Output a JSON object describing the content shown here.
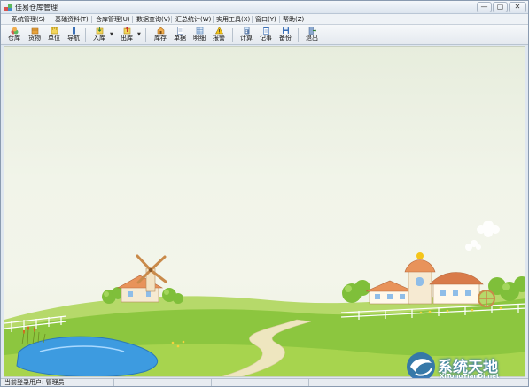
{
  "window": {
    "title": "佳易仓库管理",
    "minimize_label": "—",
    "maximize_label": "▢",
    "close_label": "✕"
  },
  "menu": [
    {
      "label": "系统管理(S)"
    },
    {
      "label": "基础资料(T)"
    },
    {
      "label": "仓库管理(U)"
    },
    {
      "label": "数据查询(V)"
    },
    {
      "label": "汇总统计(W)"
    },
    {
      "label": "实用工具(X)"
    },
    {
      "label": "窗口(Y)"
    },
    {
      "label": "帮助(Z)"
    }
  ],
  "toolbar": {
    "warehouse": "仓库",
    "goods": "货物",
    "unit": "单位",
    "guide": "导航",
    "stock_in": "入库",
    "stock_out": "出库",
    "inventory": "库存",
    "documents": "单据",
    "details": "明细",
    "alarm": "报警",
    "calculator": "计算",
    "notepad": "记事",
    "backup": "备份",
    "exit": "退出"
  },
  "status": {
    "current_user": "当前登录用户: 管理员"
  },
  "watermark": {
    "cn": "系统天地",
    "en": "XiTongTianDi.net"
  },
  "colors": {
    "accent": "#2a6fb3",
    "grass": "#8cc63f",
    "pond": "#3d9be0",
    "path": "#e8e0b8"
  }
}
